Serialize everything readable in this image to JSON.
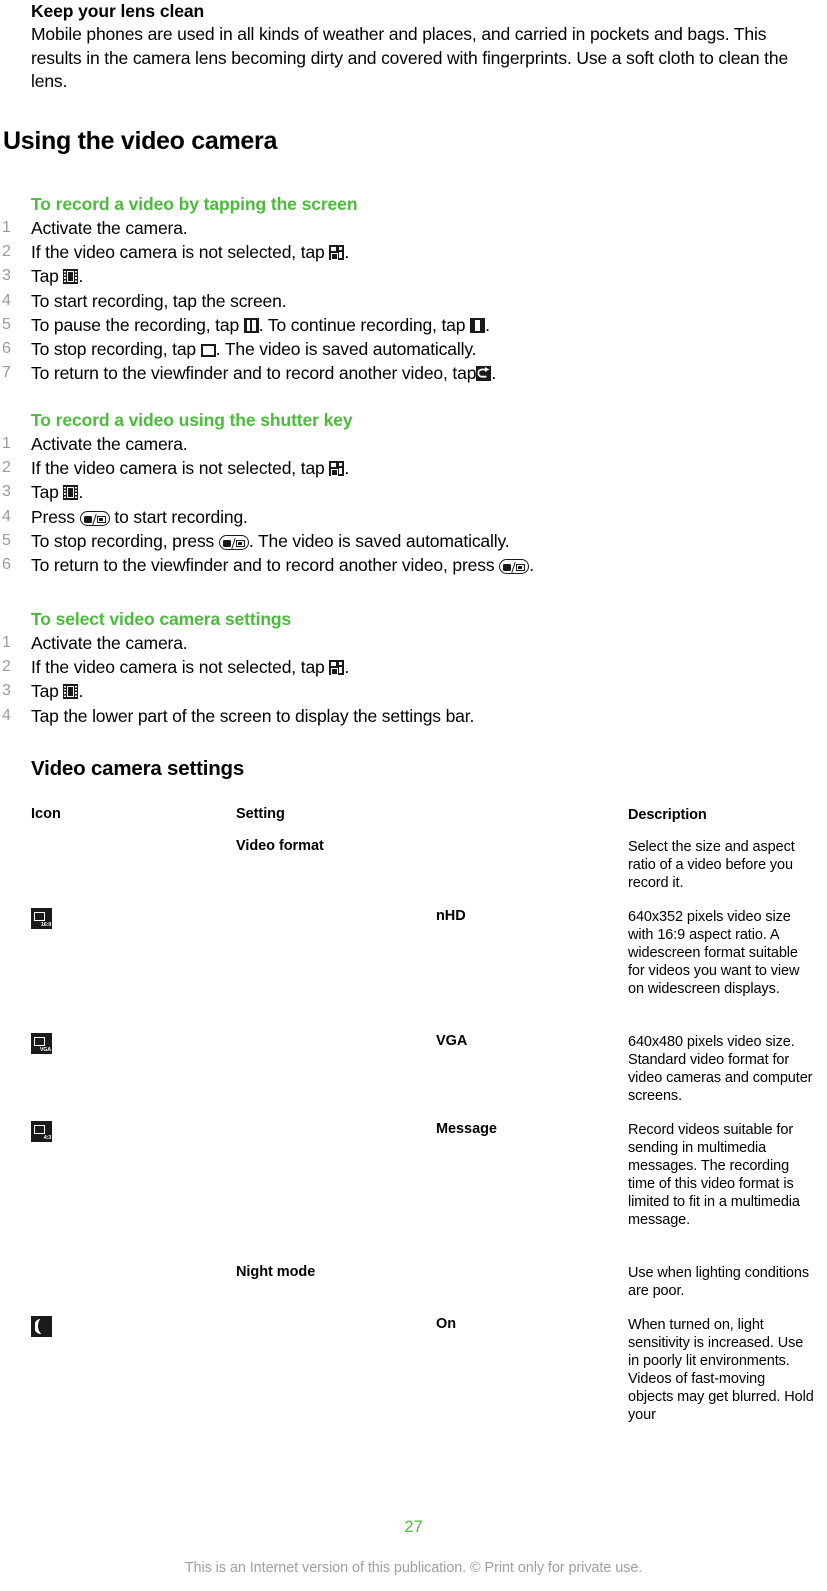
{
  "intro": {
    "title": "Keep your lens clean",
    "body": "Mobile phones are used in all kinds of weather and places, and carried in pockets and bags. This results in the camera lens becoming dirty and covered with fingerprints. Use a soft cloth to clean the lens."
  },
  "chapter": {
    "heading": "Using the video camera"
  },
  "procedures": [
    {
      "title": "To record a video by tapping the screen",
      "steps": [
        {
          "num": "1",
          "pre": "Activate the camera.",
          "icon": null,
          "post": ""
        },
        {
          "num": "2",
          "pre": "If the video camera is not selected, tap ",
          "icon": "switch-camera-icon",
          "post": "."
        },
        {
          "num": "3",
          "pre": "Tap ",
          "icon": "film-strip-icon",
          "post": "."
        },
        {
          "num": "4",
          "pre": "To start recording, tap the screen.",
          "icon": null,
          "post": ""
        },
        {
          "num": "5",
          "pre": "To pause the recording, tap ",
          "icon": "pause-icon",
          "post": ". To continue recording, tap ",
          "icon2": "resume-icon",
          "post2": "."
        },
        {
          "num": "6",
          "pre": "To stop recording, tap ",
          "icon": "stop-icon",
          "post": ". The video is saved automatically."
        },
        {
          "num": "7",
          "pre": "To return to the viewfinder and to record another video, tap",
          "icon": "return-icon",
          "post": "."
        }
      ]
    },
    {
      "title": "To record a video using the shutter key",
      "steps": [
        {
          "num": "1",
          "pre": "Activate the camera.",
          "icon": null,
          "post": ""
        },
        {
          "num": "2",
          "pre": "If the video camera is not selected, tap ",
          "icon": "switch-camera-icon",
          "post": "."
        },
        {
          "num": "3",
          "pre": "Tap ",
          "icon": "film-strip-icon",
          "post": "."
        },
        {
          "num": "4",
          "pre": "Press ",
          "icon": "shutter-key-icon",
          "post": " to start recording."
        },
        {
          "num": "5",
          "pre": "To stop recording, press ",
          "icon": "shutter-key-icon",
          "post": ". The video is saved automatically."
        },
        {
          "num": "6",
          "pre": "To return to the viewfinder and to record another video, press ",
          "icon": "shutter-key-icon",
          "post": "."
        }
      ]
    },
    {
      "title": "To select video camera settings",
      "steps": [
        {
          "num": "1",
          "pre": "Activate the camera.",
          "icon": null,
          "post": ""
        },
        {
          "num": "2",
          "pre": "If the video camera is not selected, tap ",
          "icon": "switch-camera-icon",
          "post": "."
        },
        {
          "num": "3",
          "pre": "Tap ",
          "icon": "film-strip-icon",
          "post": "."
        },
        {
          "num": "4",
          "pre": "Tap the lower part of the screen to display the settings bar.",
          "icon": null,
          "post": ""
        }
      ]
    }
  ],
  "settings_section": {
    "heading": "Video camera settings",
    "columns": {
      "icon": "Icon",
      "setting": "Setting",
      "description": "Description"
    },
    "rows": [
      {
        "icon": null,
        "icon_label": "",
        "setting": "Video format",
        "level": 1,
        "description": "Select the size and aspect ratio of a video before you record it."
      },
      {
        "icon": "video-format-nhd-icon",
        "icon_label": "16:9",
        "setting": "nHD",
        "level": 2,
        "description": "640x352 pixels video size with 16:9 aspect ratio. A widescreen format suitable for videos you want to view on widescreen displays."
      },
      {
        "icon": "video-format-vga-icon",
        "icon_label": "VGA",
        "setting": "VGA",
        "level": 2,
        "description": "640x480 pixels video size. Standard video format for video cameras and computer screens."
      },
      {
        "icon": "video-format-message-icon",
        "icon_label": "4:3",
        "setting": "Message",
        "level": 2,
        "description": "Record videos suitable for sending in multimedia messages. The recording time of this video format is limited to fit in a multimedia message."
      },
      {
        "icon": null,
        "icon_label": "",
        "setting": "Night mode",
        "level": 1,
        "description": "Use when lighting conditions are poor."
      },
      {
        "icon": "night-mode-on-icon",
        "icon_label": "",
        "setting": "On",
        "level": 2,
        "description": "When turned on, light sensitivity is increased. Use in poorly lit environments. Videos of fast-moving objects may get blurred. Hold your"
      }
    ]
  },
  "footer": {
    "page_number": "27",
    "note": "This is an Internet version of this publication. © Print only for private use."
  },
  "colors": {
    "accent_green": "#4CBB3C",
    "step_number_gray": "#9a9a9a",
    "footer_gray": "#a0a0a0",
    "icon_dark": "#1a1a1a"
  }
}
